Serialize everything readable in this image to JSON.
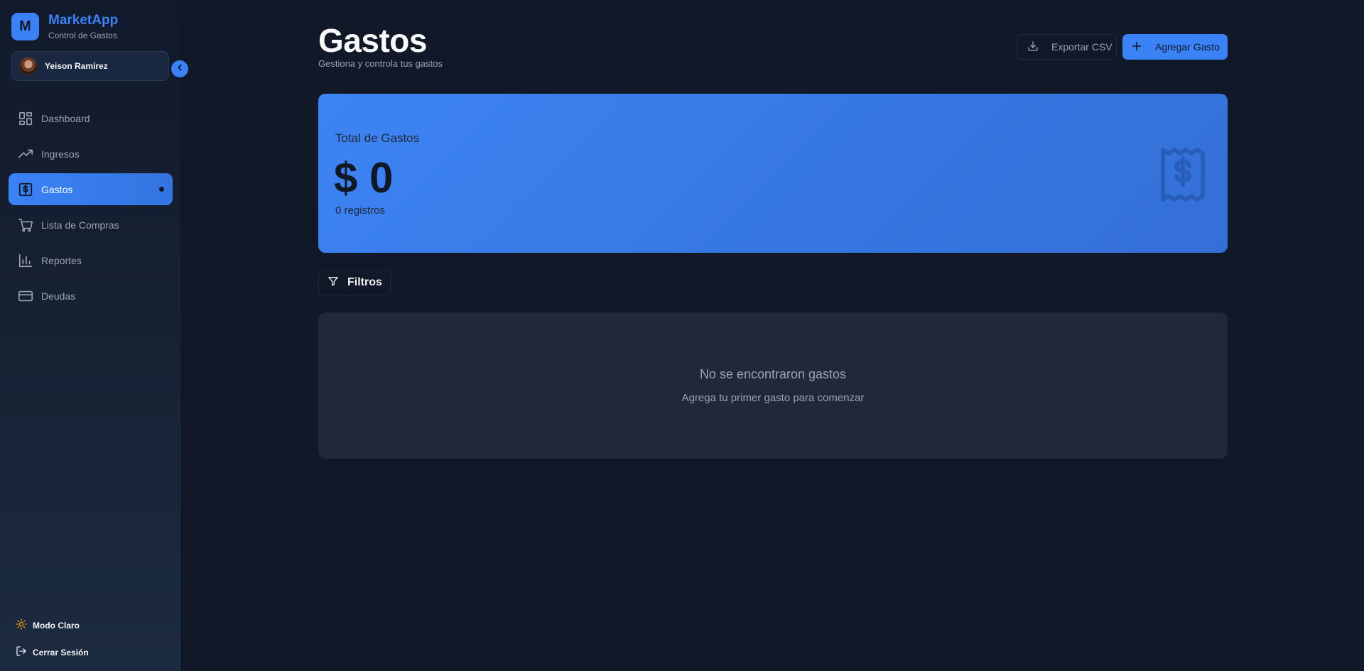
{
  "brand": {
    "logo_letter": "M",
    "name": "MarketApp",
    "subtitle": "Control de Gastos"
  },
  "user": {
    "name": "Yeison Ramírez"
  },
  "sidebar": {
    "items": [
      {
        "label": "Dashboard",
        "icon": "dashboard-grid-icon",
        "active": false
      },
      {
        "label": "Ingresos",
        "icon": "trending-up-icon",
        "active": false
      },
      {
        "label": "Gastos",
        "icon": "dollar-square-icon",
        "active": true
      },
      {
        "label": "Lista de Compras",
        "icon": "shopping-cart-icon",
        "active": false
      },
      {
        "label": "Reportes",
        "icon": "bar-chart-icon",
        "active": false
      },
      {
        "label": "Deudas",
        "icon": "credit-card-icon",
        "active": false
      }
    ],
    "theme_toggle": {
      "label": "Modo Claro",
      "icon": "sun-icon"
    },
    "logout": {
      "label": "Cerrar Sesión",
      "icon": "logout-icon"
    }
  },
  "header": {
    "title": "Gastos",
    "subtitle": "Gestiona y controla tus gastos",
    "export_label": "Exportar CSV",
    "add_label": "Agregar Gasto"
  },
  "summary": {
    "label": "Total de Gastos",
    "value": "$ 0",
    "count": "0 registros"
  },
  "filters": {
    "label": "Filtros"
  },
  "empty_state": {
    "title": "No se encontraron gastos",
    "subtitle": "Agrega tu primer gasto para comenzar"
  },
  "colors": {
    "accent": "#3b82f6",
    "background": "#111827",
    "card": "#1f2937",
    "sun": "#f59e0b"
  }
}
